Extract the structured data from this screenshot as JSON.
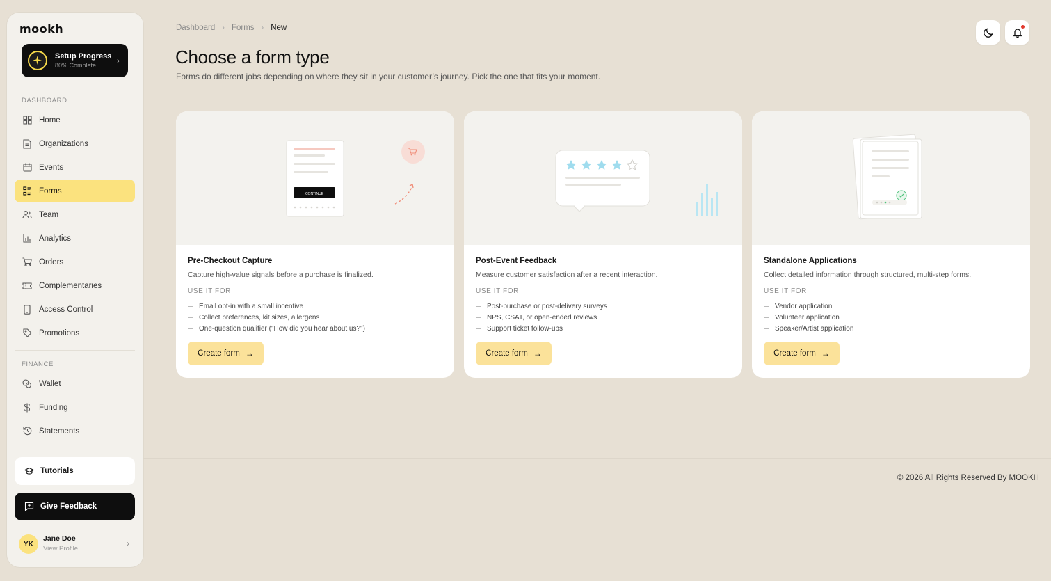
{
  "brand": {
    "logo": "mookh"
  },
  "setup": {
    "title": "Setup Progress",
    "subtitle": "80% Complete",
    "progress": 0.8
  },
  "sidebar": {
    "dashboard_label": "DASHBOARD",
    "finance_label": "FINANCE",
    "items": [
      {
        "label": "Home",
        "icon": "grid-icon"
      },
      {
        "label": "Organizations",
        "icon": "document-icon"
      },
      {
        "label": "Events",
        "icon": "calendar-icon"
      },
      {
        "label": "Forms",
        "icon": "form-list-icon",
        "active": true
      },
      {
        "label": "Team",
        "icon": "users-icon"
      },
      {
        "label": "Analytics",
        "icon": "bar-chart-icon"
      },
      {
        "label": "Orders",
        "icon": "cart-icon"
      },
      {
        "label": "Complementaries",
        "icon": "ticket-icon"
      },
      {
        "label": "Access Control",
        "icon": "phone-icon"
      },
      {
        "label": "Promotions",
        "icon": "tag-icon"
      }
    ],
    "finance_items": [
      {
        "label": "Wallet",
        "icon": "coins-icon"
      },
      {
        "label": "Funding",
        "icon": "dollar-icon"
      },
      {
        "label": "Statements",
        "icon": "history-icon"
      }
    ],
    "tutorials": "Tutorials",
    "feedback": "Give Feedback",
    "profile": {
      "initials": "YK",
      "name": "Jane Doe",
      "sub": "View Profile"
    }
  },
  "breadcrumb": [
    "Dashboard",
    "Forms",
    "New"
  ],
  "page": {
    "title": "Choose a form type",
    "subtitle": "Forms do different jobs depending on where they sit in your customer’s journey. Pick the one that fits your moment."
  },
  "illustration": {
    "continue_label": "CONTINUE"
  },
  "cards": [
    {
      "title": "Pre-Checkout Capture",
      "desc": "Capture high-value signals before a purchase is finalized.",
      "useit": "USE IT FOR",
      "items": [
        "Email opt-in with a small incentive",
        "Collect preferences, kit sizes, allergens",
        "One-question qualifier (\"How did you hear about us?\")"
      ],
      "button": "Create form"
    },
    {
      "title": "Post-Event Feedback",
      "desc": "Measure customer satisfaction after a recent interaction.",
      "useit": "USE IT FOR",
      "items": [
        "Post-purchase or post-delivery surveys",
        "NPS, CSAT, or open-ended reviews",
        "Support ticket follow-ups"
      ],
      "button": "Create form"
    },
    {
      "title": "Standalone Applications",
      "desc": "Collect detailed information through structured, multi-step forms.",
      "useit": "USE IT FOR",
      "items": [
        "Vendor application",
        "Volunteer application",
        "Speaker/Artist application"
      ],
      "button": "Create form"
    }
  ],
  "footer": "© 2026 All Rights Reserved By MOOKH",
  "colors": {
    "accent": "#fbe27e",
    "button": "#fbe29a",
    "background": "#e7e0d4",
    "dark": "#0e0e0e",
    "notification": "#e23a2e"
  }
}
